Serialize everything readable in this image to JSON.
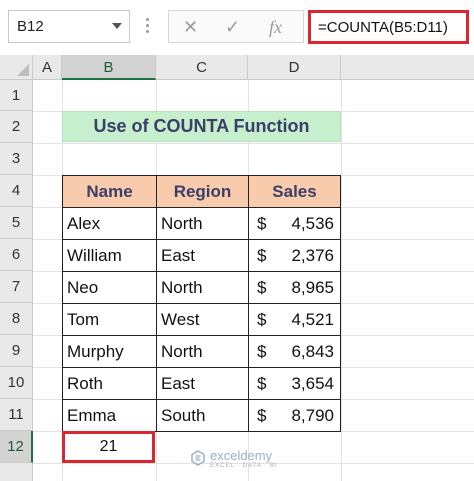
{
  "name_box": {
    "value": "B12"
  },
  "formula_bar": {
    "cancel_icon": "✕",
    "enter_icon": "✓",
    "fx_label": "fx",
    "formula": "=COUNTA(B5:D11)"
  },
  "columns": [
    "A",
    "B",
    "C",
    "D"
  ],
  "rows": [
    "1",
    "2",
    "3",
    "4",
    "5",
    "6",
    "7",
    "8",
    "9",
    "10",
    "11",
    "12"
  ],
  "title": "Use of COUNTA Function",
  "table": {
    "headers": [
      "Name",
      "Region",
      "Sales"
    ],
    "rows": [
      {
        "name": "Alex",
        "region": "North",
        "currency": "$",
        "sales": "4,536"
      },
      {
        "name": "William",
        "region": "East",
        "currency": "$",
        "sales": "2,376"
      },
      {
        "name": "Neo",
        "region": "North",
        "currency": "$",
        "sales": "8,965"
      },
      {
        "name": "Tom",
        "region": "West",
        "currency": "$",
        "sales": "4,521"
      },
      {
        "name": "Murphy",
        "region": "North",
        "currency": "$",
        "sales": "6,843"
      },
      {
        "name": "Roth",
        "region": "East",
        "currency": "$",
        "sales": "3,654"
      },
      {
        "name": "Emma",
        "region": "South",
        "currency": "$",
        "sales": "8,790"
      }
    ]
  },
  "result": "21",
  "watermark": {
    "name": "exceldemy",
    "tagline": "EXCEL · DATA · BI"
  },
  "colors": {
    "title_fill": "#c6efce",
    "header_fill": "#f8cbad",
    "highlight_border": "#d9272f",
    "selection": "#1e7145"
  }
}
